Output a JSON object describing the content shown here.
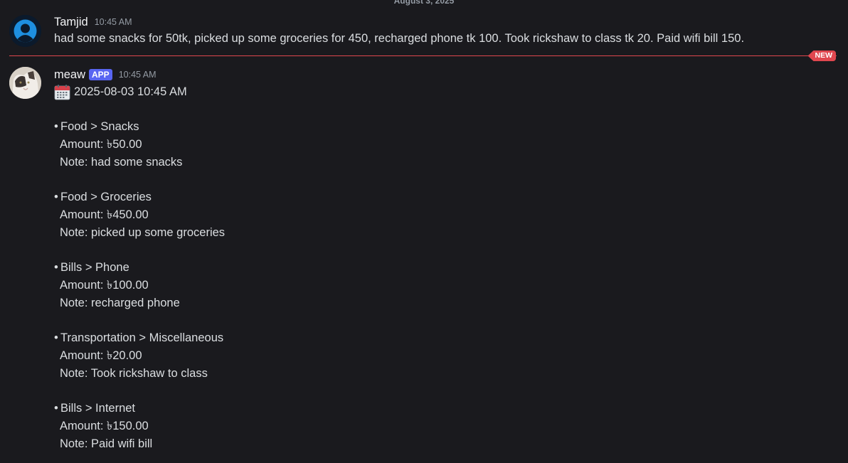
{
  "date_divider": "August 3, 2025",
  "user_message": {
    "username": "Tamjid",
    "timestamp": "10:45 AM",
    "text": "had some snacks for 50tk, picked up some groceries for 450, recharged phone tk 100. Took rickshaw to class tk 20. Paid wifi bill 150."
  },
  "new_badge": "NEW",
  "bot_message": {
    "username": "meaw",
    "app_tag": "APP",
    "timestamp": "10:45 AM",
    "date_line": "2025-08-03 10:45 AM",
    "calendar_icon": "calendar-icon",
    "expenses": [
      {
        "category": "Food > Snacks",
        "amount": "Amount: ৳50.00",
        "note": "Note: had some snacks"
      },
      {
        "category": "Food > Groceries",
        "amount": "Amount: ৳450.00",
        "note": "Note: picked up some groceries"
      },
      {
        "category": "Bills > Phone",
        "amount": "Amount: ৳100.00",
        "note": "Note: recharged phone"
      },
      {
        "category": "Transportation > Miscellaneous",
        "amount": "Amount: ৳20.00",
        "note": "Note: Took rickshaw to class"
      },
      {
        "category": "Bills > Internet",
        "amount": "Amount: ৳150.00",
        "note": "Note: Paid wifi bill"
      }
    ]
  },
  "colors": {
    "background": "#1a1a1e",
    "accent_new": "#e0474f",
    "app_tag": "#5865f2",
    "text": "#dbdee1",
    "muted": "#949ba4"
  }
}
